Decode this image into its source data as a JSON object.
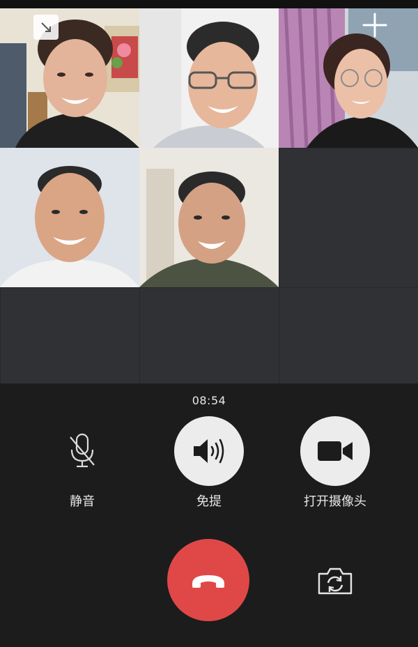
{
  "call": {
    "timer": "08:54",
    "controls": {
      "mute_label": "静音",
      "speaker_label": "免提",
      "camera_label": "打开摄像头"
    }
  },
  "colors": {
    "hangup": "#e04848",
    "control_button": "#ececec",
    "panel_background": "#1c1c1c"
  },
  "icons": {
    "minimize": "minimize-icon",
    "add": "add-participant-icon",
    "mute": "microphone-off-icon",
    "speaker": "speaker-icon",
    "camera": "video-camera-icon",
    "hangup": "phone-hangup-icon",
    "flip": "camera-flip-icon"
  }
}
